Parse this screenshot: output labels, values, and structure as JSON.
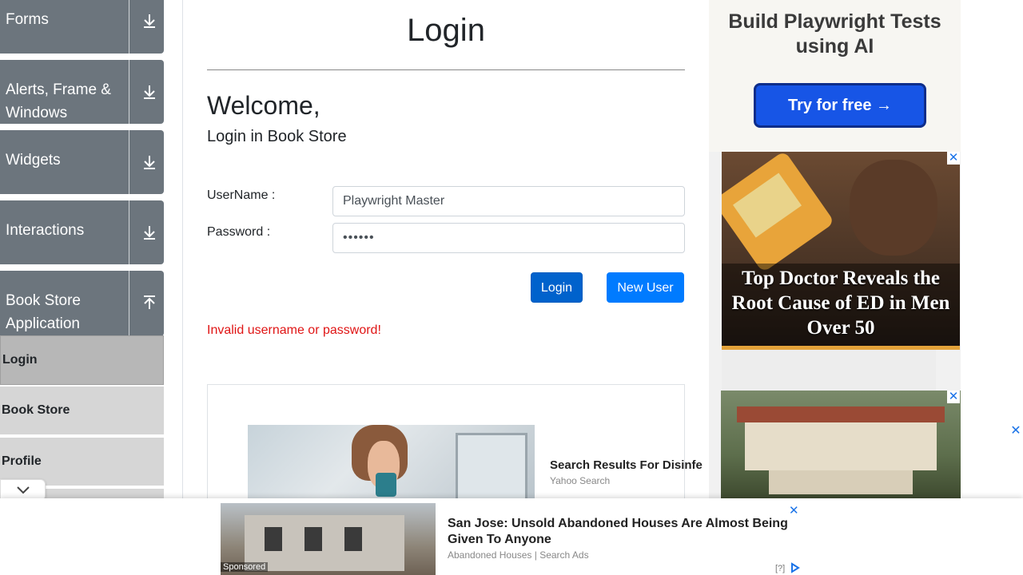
{
  "sidebar": {
    "groups": [
      {
        "label": "Forms",
        "state": "collapsed"
      },
      {
        "label": "Alerts, Frame & Windows",
        "state": "collapsed"
      },
      {
        "label": "Widgets",
        "state": "collapsed"
      },
      {
        "label": "Interactions",
        "state": "collapsed"
      },
      {
        "label": "Book Store Application",
        "state": "expanded"
      }
    ],
    "items": [
      {
        "label": "Login",
        "active": true
      },
      {
        "label": "Book Store",
        "active": false
      },
      {
        "label": "Profile",
        "active": false
      }
    ]
  },
  "main": {
    "title": "Login",
    "welcome": "Welcome,",
    "subtitle": "Login in Book Store",
    "username_label": "UserName :",
    "username_value": "Playwright Master",
    "password_label": "Password :",
    "password_value": "••••••",
    "login_button": "Login",
    "new_user_button": "New User",
    "error": "Invalid username or password!"
  },
  "inline_ad": {
    "title": "Search Results For Disinfe",
    "source": "Yahoo Search"
  },
  "right_ads": {
    "ad1_heading": "Build Playwright Tests using AI",
    "ad1_cta": "Try for free →",
    "ad2_text": "Top Doctor Reveals the Root Cause of ED in Men Over 50"
  },
  "sticky_ad": {
    "title": "San Jose: Unsold Abandoned Houses Are Almost Being Given To Anyone",
    "source": "Abandoned Houses | Search Ads",
    "sponsored": "Sponsored",
    "help": "[?]"
  },
  "colors": {
    "sidebar_group": "#6c757d",
    "primary": "#007bff",
    "error": "#e01515"
  }
}
